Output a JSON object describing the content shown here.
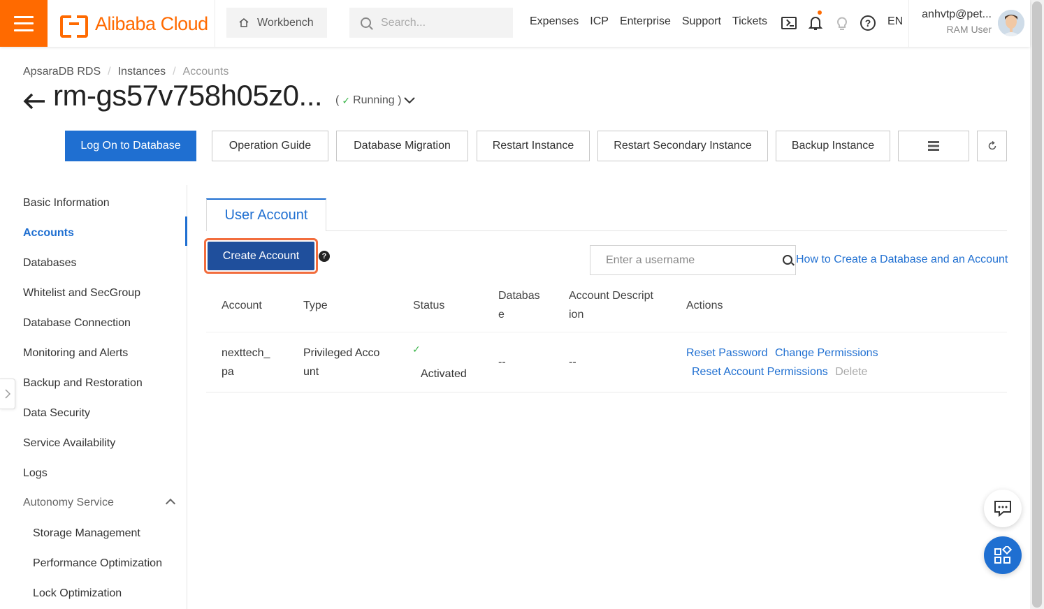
{
  "topbar": {
    "logo_text": "Alibaba Cloud",
    "workbench_label": "Workbench",
    "search_placeholder": "Search...",
    "nav": [
      "Expenses",
      "ICP",
      "Enterprise",
      "Support",
      "Tickets"
    ],
    "lang": "EN",
    "user_name": "anhvtp@pet...",
    "user_role": "RAM User",
    "accent": "#ff6a00"
  },
  "breadcrumb": [
    "ApsaraDB RDS",
    "Instances",
    "Accounts"
  ],
  "breadcrumb_sep": "/",
  "instance": {
    "title": "rm-gs57v758h05z0...",
    "status_prefix": "(",
    "status": "Running )"
  },
  "toolbar": {
    "logon": "Log On to Database",
    "guide": "Operation Guide",
    "migration": "Database Migration",
    "restart": "Restart Instance",
    "restart_secondary": "Restart Secondary Instance",
    "backup": "Backup Instance"
  },
  "sidebar": {
    "items": [
      "Basic Information",
      "Accounts",
      "Databases",
      "Whitelist and SecGroup",
      "Database Connection",
      "Monitoring and Alerts",
      "Backup and Restoration",
      "Data Security",
      "Service Availability",
      "Logs"
    ],
    "group": "Autonomy Service",
    "sub_items": [
      "Storage Management",
      "Performance Optimization",
      "Lock Optimization"
    ]
  },
  "content": {
    "tab": "User Account",
    "create_button": "Create Account",
    "help_mark": "?",
    "username_placeholder": "Enter a username",
    "howto_link": "How to Create a Database and an Account",
    "columns": {
      "account": "Account",
      "type": "Type",
      "status": "Status",
      "database_1": "Databas",
      "database_2": "e",
      "desc_1": "Account Descript",
      "desc_2": "ion",
      "actions": "Actions"
    },
    "row": {
      "account_1": "nexttech_",
      "account_2": "pa",
      "type_1": "Privileged Acco",
      "type_2": "unt",
      "status": "Activated",
      "database": "--",
      "description": "--",
      "action_reset_password": "Reset Password",
      "action_change_permissions": "Change Permissions",
      "action_reset_account_permissions": "Reset Account Permissions",
      "action_delete": "Delete"
    }
  },
  "colors": {
    "primary": "#1f6fd1",
    "highlight_border": "#f26d3d",
    "success": "#3bb54a"
  }
}
